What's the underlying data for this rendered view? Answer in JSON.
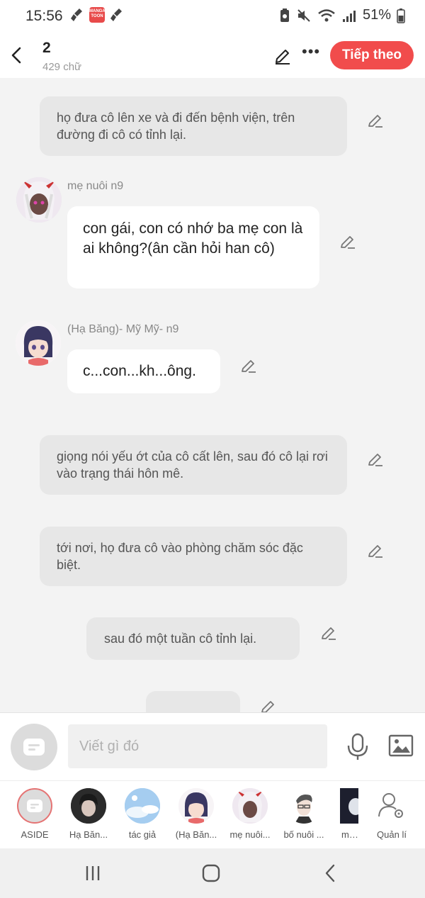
{
  "status_bar": {
    "time": "15:56",
    "battery": "51%",
    "app_badge": "MANGA TOON"
  },
  "header": {
    "back_icon": "chevron-left-icon",
    "title": "2",
    "word_count": "429 chữ",
    "next_label": "Tiếp theo"
  },
  "messages": [
    {
      "type": "narration",
      "text": "họ đưa cô lên xe và đi đến bệnh viện, trên đường đi cô có tỉnh lại."
    },
    {
      "type": "dialogue",
      "speaker": "mẹ nuôi n9",
      "text": "con gái, con có nhớ ba mẹ con là ai không?(ân cần hỏi han cô)"
    },
    {
      "type": "dialogue",
      "speaker": "(Hạ Băng)- Mỹ Mỹ- n9",
      "text": "c...con...kh...ông."
    },
    {
      "type": "narration",
      "text": "giọng nói yếu ớt của cô cất lên, sau đó cô lại rơi vào trạng thái hôn mê."
    },
    {
      "type": "narration",
      "text": "tới nơi, họ đưa cô vào phòng chăm sóc đặc biệt."
    },
    {
      "type": "narration",
      "text": "sau đó một tuần cô tỉnh lại."
    }
  ],
  "composer": {
    "placeholder": "Viết gì đó"
  },
  "characters": [
    {
      "label": "ASIDE"
    },
    {
      "label": "Hạ Băn..."
    },
    {
      "label": "tác giả"
    },
    {
      "label": "(Hạ Băn..."
    },
    {
      "label": "mẹ nuôi..."
    },
    {
      "label": "bố nuôi ..."
    },
    {
      "label": "mẹ r"
    },
    {
      "label": "Quản lí"
    }
  ],
  "colors": {
    "accent": "#f14c4c",
    "background": "#f3f3f3",
    "narration_bg": "#e7e7e7"
  }
}
